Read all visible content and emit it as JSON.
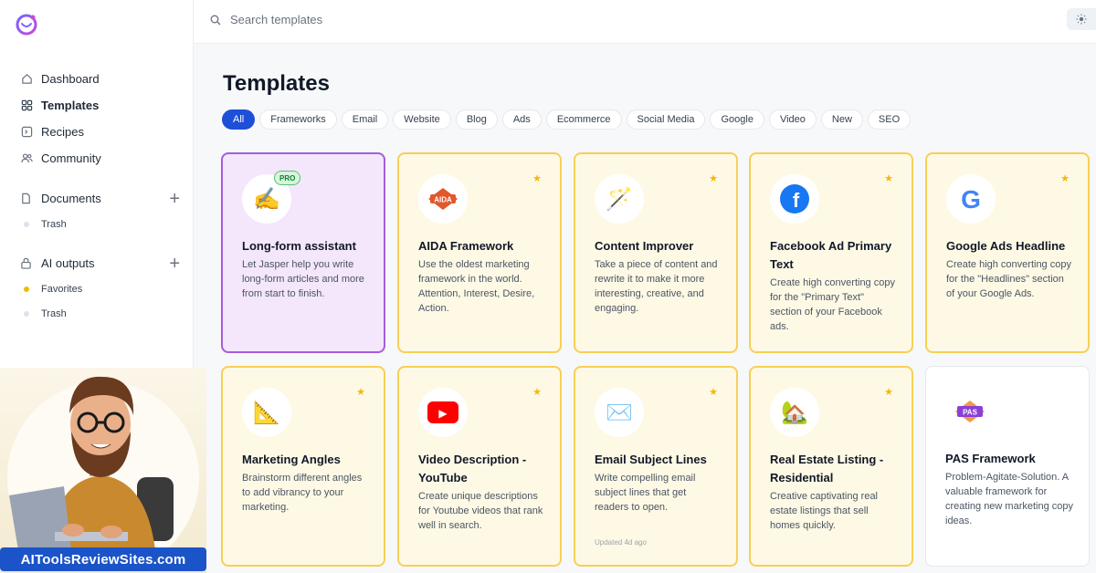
{
  "search": {
    "placeholder": "Search templates"
  },
  "sidebar": {
    "nav": [
      {
        "label": "Dashboard"
      },
      {
        "label": "Templates"
      },
      {
        "label": "Recipes"
      },
      {
        "label": "Community"
      }
    ],
    "documents": {
      "label": "Documents",
      "trash": "Trash"
    },
    "ai_outputs": {
      "label": "AI outputs",
      "favorites": "Favorites",
      "trash": "Trash"
    }
  },
  "promo": {
    "banner": "AIToolsReviewSites.com"
  },
  "main": {
    "title": "Templates",
    "filters": [
      "All",
      "Frameworks",
      "Email",
      "Website",
      "Blog",
      "Ads",
      "Ecommerce",
      "Social Media",
      "Google",
      "Video",
      "New",
      "SEO"
    ],
    "cards": [
      {
        "title": "Long-form assistant",
        "desc": "Let Jasper help you write long-form articles and more from start to finish.",
        "badge": "PRO",
        "icon": "✍️"
      },
      {
        "title": "AIDA Framework",
        "desc": "Use the oldest marketing framework in the world. Attention, Interest, Desire, Action.",
        "icon": "AIDA"
      },
      {
        "title": "Content Improver",
        "desc": "Take a piece of content and rewrite it to make it more interesting, creative, and engaging.",
        "icon": "🪄"
      },
      {
        "title": "Facebook Ad Primary Text",
        "desc": "Create high converting copy for the \"Primary Text\" section of your Facebook ads.",
        "icon": "f"
      },
      {
        "title": "Google Ads Headline",
        "desc": "Create high converting copy for the \"Headlines\" section of your Google Ads.",
        "icon": "G"
      },
      {
        "title": "Marketing Angles",
        "desc": "Brainstorm different angles to add vibrancy to your marketing.",
        "icon": "📐"
      },
      {
        "title": "Video Description - YouTube",
        "desc": "Create unique descriptions for Youtube videos that rank well in search.",
        "icon": "▶"
      },
      {
        "title": "Email Subject Lines",
        "desc": "Write compelling email subject lines that get readers to open.",
        "updated": "Updated 4d ago",
        "icon": "✉️"
      },
      {
        "title": "Real Estate Listing - Residential",
        "desc": "Creative captivating real estate listings that sell homes quickly.",
        "icon": "🏡"
      },
      {
        "title": "PAS Framework",
        "desc": "Problem-Agitate-Solution. A valuable framework for creating new marketing copy ideas.",
        "icon": "PAS"
      }
    ]
  },
  "colors": {
    "accent": "#1d4fd8",
    "star": "#f5b800",
    "card_border": "#f7d054",
    "pro_border": "#a55ed9"
  }
}
